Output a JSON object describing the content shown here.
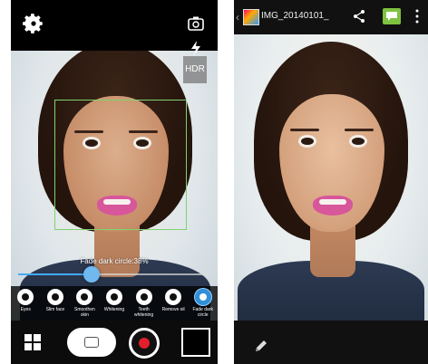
{
  "camera": {
    "hdr_label": "HDR",
    "slider_label": "Fade dark circle:38%",
    "slider_value_percent": 38,
    "tools": [
      {
        "icon": "eye-icon",
        "label": "Eyes"
      },
      {
        "icon": "slim-face-icon",
        "label": "Slim face"
      },
      {
        "icon": "smoothen-skin-icon",
        "label": "Smoothen skin"
      },
      {
        "icon": "whitening-icon",
        "label": "Whitening"
      },
      {
        "icon": "teeth-whitening-icon",
        "label": "Teeth whitening"
      },
      {
        "icon": "remove-oil-icon",
        "label": "Remove oil"
      },
      {
        "icon": "fade-dark-circle-icon",
        "label": "Fade dark circle",
        "active": true
      }
    ]
  },
  "gallery": {
    "title": "IMG_20140101_",
    "icons": [
      "share-icon",
      "message-icon",
      "overflow-menu-icon",
      "pencil-icon"
    ]
  },
  "colors": {
    "accent": "#44aaf5",
    "detect_box": "#7fd36e",
    "record": "#e21f2a",
    "message_green": "#7fc241",
    "lips": "#d8569a"
  }
}
